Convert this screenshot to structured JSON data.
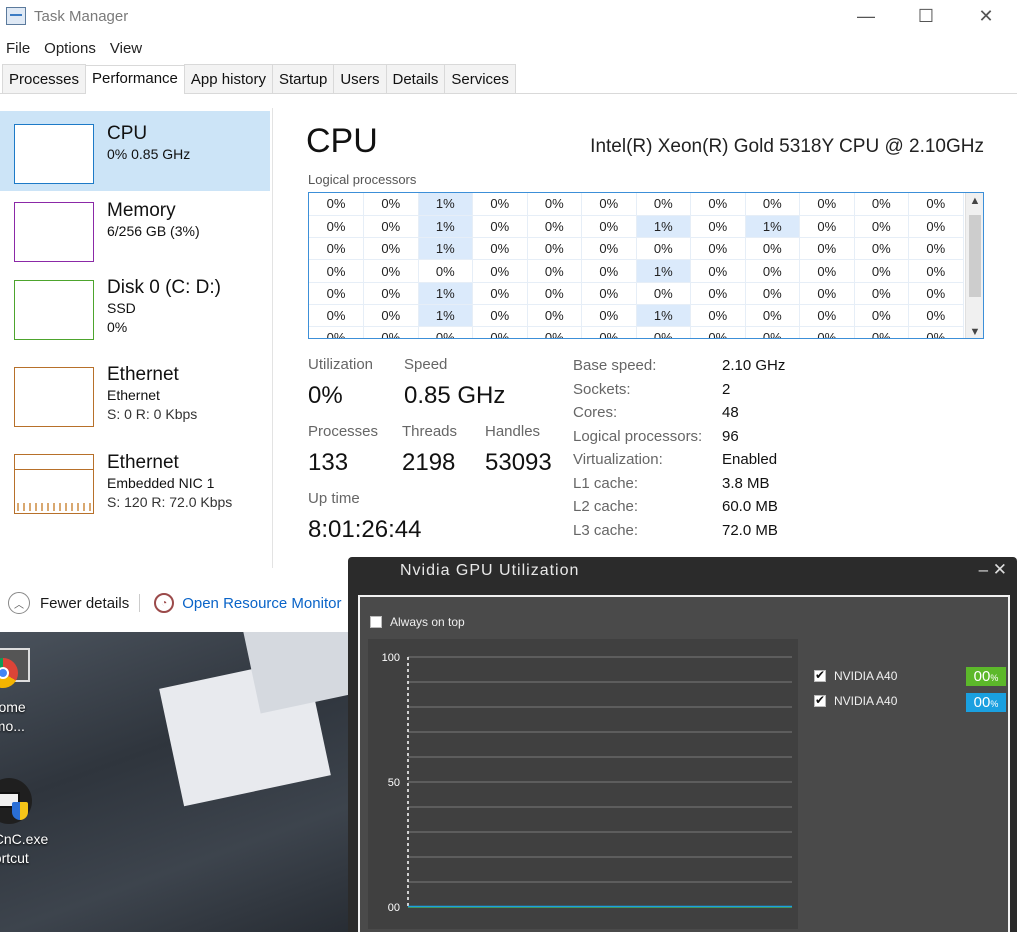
{
  "window": {
    "title": "Task Manager",
    "minimize": "—",
    "maximize": "☐",
    "close": "✕"
  },
  "menu": [
    "File",
    "Options",
    "View"
  ],
  "tabs": [
    "Processes",
    "Performance",
    "App history",
    "Startup",
    "Users",
    "Details",
    "Services"
  ],
  "active_tab": "Performance",
  "sidebar": {
    "cpu": {
      "name": "CPU",
      "sub": "0% 0.85 GHz"
    },
    "memory": {
      "name": "Memory",
      "sub": "6/256 GB (3%)"
    },
    "disk": {
      "name": "Disk 0 (C: D:)",
      "sub": "SSD",
      "sub2": "0%"
    },
    "ethernet1": {
      "name": "Ethernet",
      "sub": "Ethernet",
      "sub2": "S: 0 R: 0 Kbps"
    },
    "ethernet2": {
      "name": "Ethernet",
      "sub": "Embedded NIC 1",
      "sub2": "S: 120 R: 72.0 Kbps"
    }
  },
  "cpu": {
    "title": "CPU",
    "model": "Intel(R) Xeon(R) Gold 5318Y CPU @ 2.10GHz",
    "logical_label": "Logical processors",
    "grid": [
      [
        "0%",
        "0%",
        "1%",
        "0%",
        "0%",
        "0%",
        "0%",
        "0%",
        "0%",
        "0%",
        "0%",
        "0%"
      ],
      [
        "0%",
        "0%",
        "1%",
        "0%",
        "0%",
        "0%",
        "1%",
        "0%",
        "1%",
        "0%",
        "0%",
        "0%"
      ],
      [
        "0%",
        "0%",
        "1%",
        "0%",
        "0%",
        "0%",
        "0%",
        "0%",
        "0%",
        "0%",
        "0%",
        "0%"
      ],
      [
        "0%",
        "0%",
        "0%",
        "0%",
        "0%",
        "0%",
        "1%",
        "0%",
        "0%",
        "0%",
        "0%",
        "0%"
      ],
      [
        "0%",
        "0%",
        "1%",
        "0%",
        "0%",
        "0%",
        "0%",
        "0%",
        "0%",
        "0%",
        "0%",
        "0%"
      ],
      [
        "0%",
        "0%",
        "1%",
        "0%",
        "0%",
        "0%",
        "1%",
        "0%",
        "0%",
        "0%",
        "0%",
        "0%"
      ],
      [
        "0%",
        "0%",
        "0%",
        "0%",
        "0%",
        "0%",
        "0%",
        "0%",
        "0%",
        "0%",
        "0%",
        "0%"
      ]
    ],
    "highlight": [
      [
        0,
        2
      ],
      [
        1,
        2
      ],
      [
        1,
        6
      ],
      [
        1,
        8
      ],
      [
        2,
        2
      ],
      [
        3,
        6
      ],
      [
        4,
        2
      ],
      [
        5,
        2
      ],
      [
        5,
        6
      ]
    ],
    "stats": {
      "utilization_label": "Utilization",
      "utilization": "0%",
      "speed_label": "Speed",
      "speed": "0.85 GHz",
      "processes_label": "Processes",
      "processes": "133",
      "threads_label": "Threads",
      "threads": "2198",
      "handles_label": "Handles",
      "handles": "53093",
      "uptime_label": "Up time",
      "uptime": "8:01:26:44"
    },
    "specs": [
      [
        "Base speed:",
        "2.10 GHz"
      ],
      [
        "Sockets:",
        "2"
      ],
      [
        "Cores:",
        "48"
      ],
      [
        "Logical processors:",
        "96"
      ],
      [
        "Virtualization:",
        "Enabled"
      ],
      [
        "L1 cache:",
        "3.8 MB"
      ],
      [
        "L2 cache:",
        "60.0 MB"
      ],
      [
        "L3 cache:",
        "72.0 MB"
      ]
    ]
  },
  "footer": {
    "fewer": "Fewer details",
    "monitor": "Open Resource Monitor"
  },
  "desktop": {
    "icon1": [
      "hrome",
      "emo..."
    ],
    "icon2": [
      "_CnC.exe",
      "hortcut"
    ]
  },
  "gpu_window": {
    "title": "Nvidia GPU Utilization",
    "controls": "– ✕",
    "always_on_top": "Always on top",
    "legend": [
      {
        "name": "NVIDIA A40",
        "value": "00",
        "unit": "%",
        "color": "#5cb82a"
      },
      {
        "name": "NVIDIA A40",
        "value": "00",
        "unit": "%",
        "color": "#1aa0e0"
      }
    ]
  },
  "chart_data": {
    "type": "line",
    "yticks": [
      "100",
      "50",
      "00"
    ],
    "ylim": [
      0,
      100
    ],
    "grid": true,
    "series": [
      {
        "name": "NVIDIA A40",
        "values": [
          0,
          0,
          0,
          0,
          0,
          0,
          0,
          0,
          0,
          0
        ]
      },
      {
        "name": "NVIDIA A40",
        "values": [
          0,
          0,
          0,
          0,
          0,
          0,
          0,
          0,
          0,
          0
        ]
      }
    ]
  }
}
